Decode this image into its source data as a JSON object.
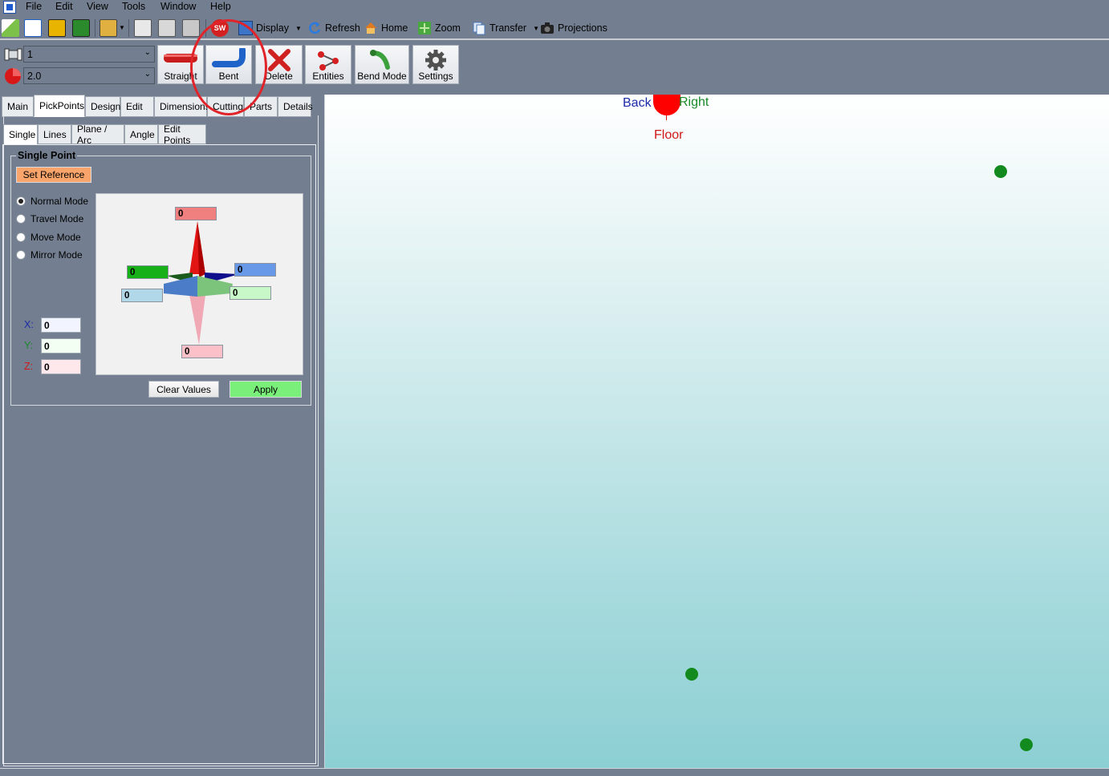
{
  "menu": [
    "File",
    "Edit",
    "View",
    "Tools",
    "Window",
    "Help"
  ],
  "toolbar": {
    "display": "Display",
    "refresh": "Refresh",
    "home": "Home",
    "zoom": "Zoom",
    "transfer": "Transfer",
    "projections": "Projections",
    "sw_badge": "SW"
  },
  "ribbon": {
    "pipe_combo": "1",
    "radius_combo": "2.0",
    "buttons": {
      "straight": "Straight",
      "bent": "Bent",
      "delete": "Delete",
      "entities": "Entities",
      "bend_mode": "Bend Mode",
      "settings": "Settings"
    }
  },
  "main_tabs": [
    "Main",
    "PickPoints",
    "Design",
    "Edit",
    "Dimensions",
    "Cutting",
    "Parts",
    "Details"
  ],
  "main_tab_active": "PickPoints",
  "sub_tabs": [
    "Single",
    "Lines",
    "Plane / Arc",
    "Angle",
    "Edit Points"
  ],
  "sub_tab_active": "Single",
  "single_point": {
    "title": "Single Point",
    "set_reference": "Set Reference",
    "modes": [
      "Normal Mode",
      "Travel Mode",
      "Move Mode",
      "Mirror Mode"
    ],
    "selected_mode": "Normal Mode",
    "x_label": "X:",
    "y_label": "Y:",
    "z_label": "Z:",
    "x": "0",
    "y": "0",
    "z": "0",
    "gizmo": {
      "up": "0",
      "down": "0",
      "left_upper": "0",
      "left_lower": "0",
      "right_upper": "0",
      "right_lower": "0"
    },
    "clear_values": "Clear Values",
    "apply": "Apply"
  },
  "viewport": {
    "labels": {
      "back": "Back",
      "right": "Right",
      "floor": "Floor"
    },
    "colors": {
      "back": "#1a2aa8",
      "right": "#1a8a28",
      "floor": "#d01818",
      "points": "#138a1e",
      "sphere": "#ff0000"
    }
  },
  "annotation": {
    "color": "#e0242a",
    "target": "Bent"
  }
}
